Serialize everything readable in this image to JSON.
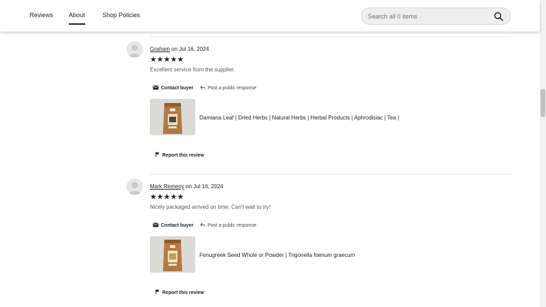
{
  "nav": {
    "tabs": [
      {
        "label": "Reviews"
      },
      {
        "label": "About"
      },
      {
        "label": "Shop Policies"
      }
    ],
    "active_tab": "About"
  },
  "search": {
    "placeholder": "Search all 0 items",
    "icon": "search-icon"
  },
  "reviews": [
    {
      "reviewer": "Graham",
      "date_text": " on Jul 16, 2024",
      "stars": "★★★★★",
      "rating": 5,
      "text": "Excellent service from the supplier.",
      "contact_label": "Contact buyer",
      "post_label": "Post a public response",
      "product_title": "Damiana Leaf | Dried Herbs | Natural Herbs | Herbal Products | Aphrodisiac | Tea |",
      "report_label": "Report this review"
    },
    {
      "reviewer": "Mark Remeny",
      "date_text": " on Jul 16, 2024",
      "stars": "★★★★★",
      "rating": 5,
      "text": "Nicely packaged arrived on time. Can't wait to try!",
      "contact_label": "Contact buyer",
      "post_label": "Post a public response",
      "product_title": "Fenugreek Seed Whole or Powder | Trigonella foenum graecum",
      "report_label": "Report this review"
    }
  ],
  "colors": {
    "text": "#222222",
    "muted": "#595959",
    "search_bg": "#efefef",
    "package": "#b07a45"
  }
}
